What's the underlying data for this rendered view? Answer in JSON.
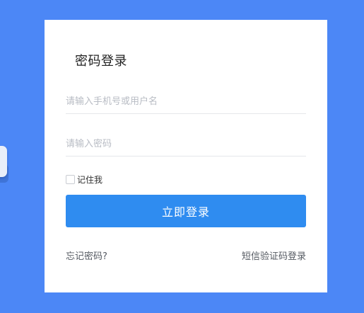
{
  "login": {
    "title": "密码登录",
    "username_placeholder": "请输入手机号或用户名",
    "password_placeholder": "请输入密码",
    "remember_label": "记住我",
    "remember_checked": false,
    "submit_label": "立即登录",
    "forgot_label": "忘记密码?",
    "sms_login_label": "短信验证码登录"
  },
  "colors": {
    "background": "#4c87f6",
    "card": "#ffffff",
    "primary_button": "#2f8cf0"
  }
}
